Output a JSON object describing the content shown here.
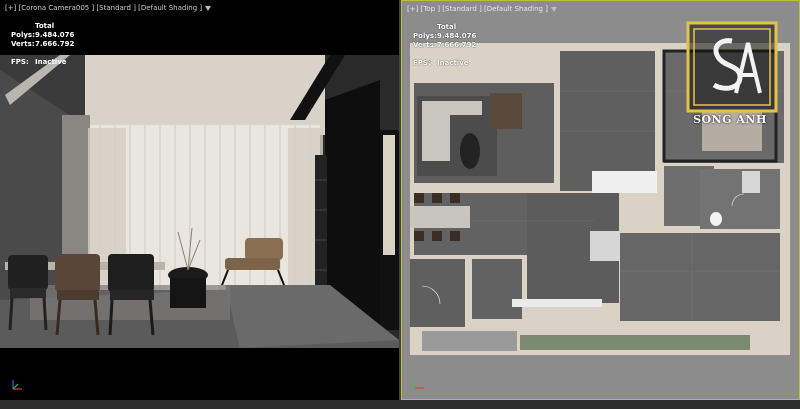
{
  "left_viewport": {
    "label": "[+] [Corona Camera005 ] [Standard ] [Default Shading ]",
    "stats": {
      "header": "Total",
      "polys_label": "Polys:",
      "polys_value": "9.484.076",
      "verts_label": "Verts:",
      "verts_value": "7.666.792"
    },
    "fps_label": "FPS:",
    "fps_value": "Inactive"
  },
  "right_viewport": {
    "label": "[+] [Top ] [Standard ] [Default Shading ]",
    "stats": {
      "header": "Total",
      "polys_label": "Polys:",
      "polys_value": "9.484.076",
      "verts_label": "Verts:",
      "verts_value": "7.666.792"
    },
    "fps_label": "FPS:",
    "fps_value": "Inactive",
    "logo_text": "SONG ANH"
  },
  "colors": {
    "active_viewport_border": "#bdbd40",
    "axis_x": "#d04040",
    "axis_y": "#40c040",
    "axis_z": "#4060e0",
    "logo_gold": "#e3c44a"
  }
}
